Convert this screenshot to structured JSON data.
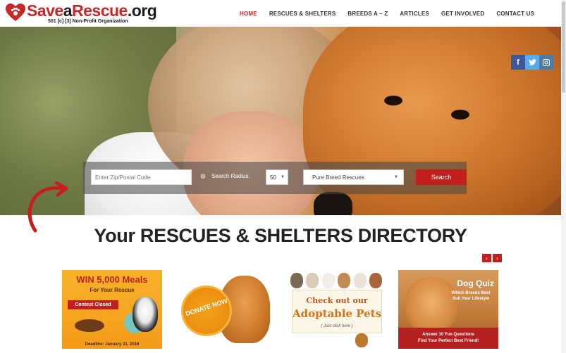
{
  "header": {
    "logo_save": "Save",
    "logo_a": "a",
    "logo_rescue": "Rescue",
    "logo_domain": ".org",
    "tagline": "501 [c] [3] Non-Profit Organization",
    "nav": [
      "HOME",
      "RESCUES & SHELTERS",
      "BREEDS A – Z",
      "ARTICLES",
      "GET INVOLVED",
      "CONTACT US"
    ],
    "active_nav": "HOME",
    "accent_color": "#c62828"
  },
  "social": {
    "facebook": "f",
    "twitter": "t",
    "instagram": "instagram-icon"
  },
  "search": {
    "zip_placeholder": "Enter Zip/Postal Code",
    "radius_label": "Search Radius:",
    "radius_value": "50",
    "breed_value": "Pure Breed Rescues",
    "button_label": "Search"
  },
  "directory": {
    "title_your": "Your",
    "title_rescues": "RESCUES",
    "title_amp": "&",
    "title_shelters": "SHELTERS DIRECTORY"
  },
  "carousel": {
    "prev": "‹",
    "next": "›",
    "cards": {
      "meals": {
        "headline": "WIN 5,000 Meals",
        "subline": "For Your Rescue",
        "badge": "Contest Closed",
        "deadline": "Deadline: January 31, 2016"
      },
      "donate": {
        "badge": "DONATE NOW"
      },
      "adoptable": {
        "line1": "Check out our",
        "line2": "Adoptable Pets",
        "line3": "( Just click here )"
      },
      "quiz": {
        "title": "Dog Quiz",
        "subtitle": "Which Breeds Best Suit Your Lifestyle",
        "footer1": "Answer 10 Fun Questions",
        "footer2": "Find Your Perfect Best Friend!"
      }
    }
  }
}
